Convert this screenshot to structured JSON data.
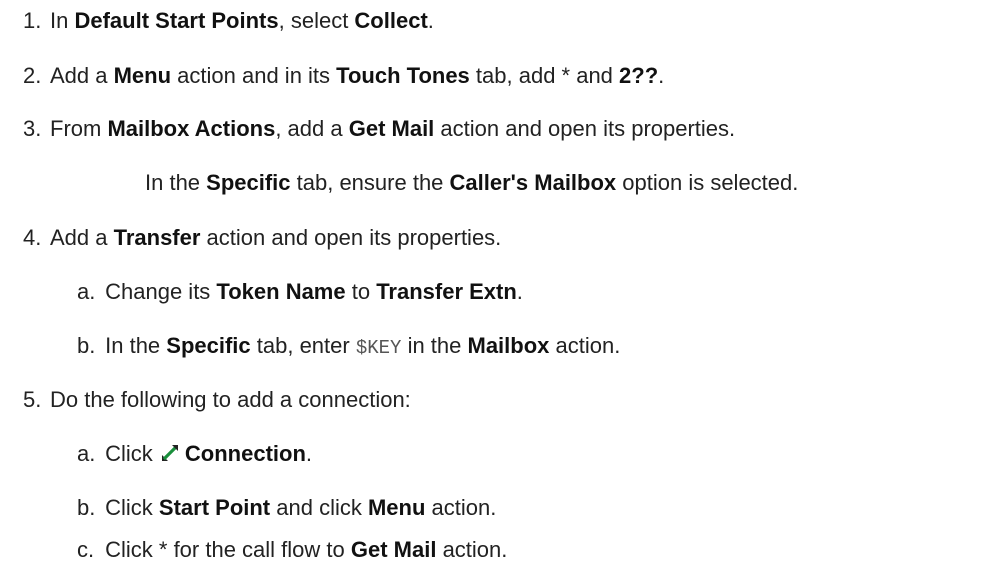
{
  "steps": [
    {
      "num": "1.",
      "parts": [
        "In ",
        "Default Start Points",
        ", select ",
        "Collect",
        "."
      ]
    },
    {
      "num": "2.",
      "parts": [
        "Add a ",
        "Menu",
        " action and in its ",
        "Touch Tones",
        " tab, add * and ",
        "2??",
        "."
      ]
    },
    {
      "num": "3.",
      "parts": [
        "From ",
        "Mailbox Actions",
        ", add a ",
        "Get Mail",
        " action and open its properties."
      ],
      "note": [
        "In the ",
        "Specific",
        " tab, ensure the ",
        "Caller's Mailbox",
        " option is selected."
      ]
    },
    {
      "num": "4.",
      "parts": [
        "Add a ",
        "Transfer",
        " action and open its properties."
      ],
      "substeps": [
        {
          "letter": "a.",
          "parts": [
            "Change its ",
            "Token Name",
            " to ",
            "Transfer Extn",
            "."
          ]
        },
        {
          "letter": "b.",
          "parts": [
            "In the ",
            "Specific",
            " tab, enter ",
            "$KEY",
            " in the ",
            "Mailbox",
            " action."
          ]
        }
      ]
    },
    {
      "num": "5.",
      "parts": [
        "Do the following to add a connection:"
      ],
      "substeps": [
        {
          "letter": "a.",
          "parts": [
            "Click ",
            "Connection",
            "."
          ],
          "icon": "connection-icon"
        },
        {
          "letter": "b.",
          "parts": [
            "Click ",
            "Start Point",
            " and click ",
            "Menu",
            " action."
          ]
        },
        {
          "letter": "c.",
          "parts": [
            "Click * for the call flow to ",
            "Get Mail",
            " action."
          ]
        }
      ]
    }
  ],
  "colors": {
    "text": "#222222",
    "icon_green": "#1a8f3c",
    "icon_dark": "#222222"
  }
}
